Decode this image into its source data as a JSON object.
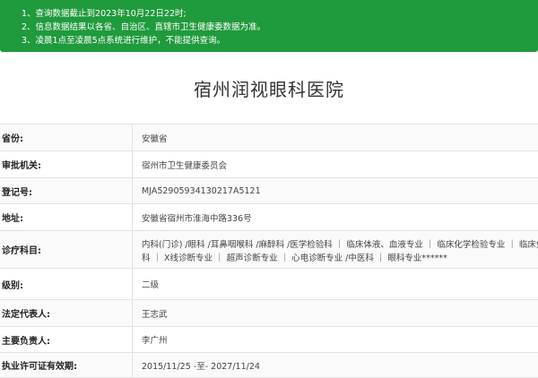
{
  "notice": {
    "lines": [
      "1、查询数据截止到2023年10月22日22时;",
      "2、信息数据结果以各省、自治区、直辖市卫生健康委数据为准。",
      "3、凌晨1点至凌晨5点系统进行维护，不能提供查询。"
    ]
  },
  "hospital": {
    "name": "宿州润视眼科医院"
  },
  "rows": [
    {
      "label": "省份:",
      "value": "安徽省"
    },
    {
      "label": "审批机关:",
      "value": "宿州市卫生健康委员会"
    },
    {
      "label": "登记号:",
      "value": "MJA52905934130217A5121"
    },
    {
      "label": "地址:",
      "value": "安徽省宿州市淮海中路336号"
    },
    {
      "label": "诊疗科目:",
      "value_lines": [
        "内科(门诊) /眼科 /耳鼻咽喉科 /麻醉科 /医学检验科 ｜ 临床体液、血液专业 ｜ 临床化学检验专业 ｜ 临床免疫、血清学专业 /医学影像",
        "科 ｜ X线诊断专业 ｜ 超声诊断专业 ｜ 心电诊断专业 /中医科 ｜ 眼科专业******"
      ]
    },
    {
      "label": "级别:",
      "value": "二级"
    },
    {
      "label": "法定代表人:",
      "value": "王志武"
    },
    {
      "label": "主要负责人:",
      "value": "李广州"
    },
    {
      "label": "执业许可证有效期:",
      "value": "2015/11/25 -至- 2027/11/24"
    }
  ]
}
